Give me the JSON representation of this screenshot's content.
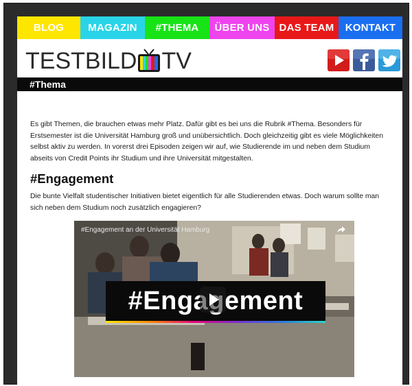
{
  "nav": {
    "items": [
      {
        "label": "BLOG",
        "color": "#ffe600"
      },
      {
        "label": "MAGAZIN",
        "color": "#29d4e8"
      },
      {
        "label": "#THEMA",
        "color": "#17e317"
      },
      {
        "label": "ÜBER UNS",
        "color": "#ee44ee"
      },
      {
        "label": "DAS TEAM",
        "color": "#e81818"
      },
      {
        "label": "KONTAKT",
        "color": "#1a6ef0"
      }
    ]
  },
  "header": {
    "logo_left": "TESTBILD",
    "logo_right": "TV",
    "social": [
      "youtube-icon",
      "facebook-icon",
      "twitter-icon"
    ]
  },
  "titlebar": {
    "label": "#Thema"
  },
  "intro": {
    "line1": "Es gibt Themen, die brauchen etwas mehr Platz. Dafür gibt es bei uns die Rubrik #Thema. Besonders für",
    "line2": "Erstsemester ist die Universität Hamburg groß und unübersichtlich. Doch gleichzeitig gibt es viele Möglichkeiten",
    "line3": "selbst aktiv zu werden. In vorerst drei Episoden zeigen wir auf, wie Studierende im und neben dem Studium",
    "line4": "abseits von Credit Points ihr Studium und ihre Universität mitgestalten."
  },
  "section": {
    "heading": "#Engagement",
    "desc_line1": "Die bunte Vielfalt studentischer Initiativen bietet eigentlich für alle Studierenden etwas. Doch warum sollte man",
    "desc_line2": "sich neben dem Studium noch zusätzlich engagieren?"
  },
  "video": {
    "title": "#Engagement an der Universität Hamburg",
    "overlay": "#Engagement"
  }
}
